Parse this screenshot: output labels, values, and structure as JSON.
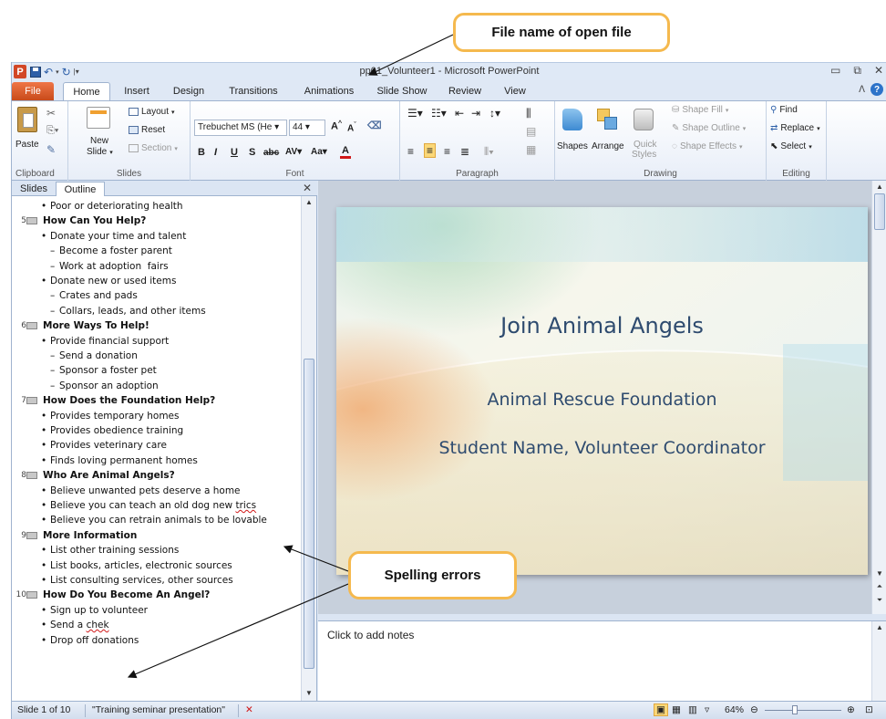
{
  "callouts": {
    "file_name": "File name of open file",
    "spelling": "Spelling errors"
  },
  "window": {
    "title": "pp01_Volunteer1 - Microsoft PowerPoint"
  },
  "tabs": [
    "File",
    "Home",
    "Insert",
    "Design",
    "Transitions",
    "Animations",
    "Slide Show",
    "Review",
    "View"
  ],
  "active_tab": "Home",
  "ribbon": {
    "clipboard": {
      "label": "Clipboard",
      "paste": "Paste"
    },
    "slides": {
      "label": "Slides",
      "new_slide": "New",
      "new_slide2": "Slide",
      "layout": "Layout",
      "reset": "Reset",
      "section": "Section"
    },
    "font": {
      "label": "Font",
      "font_name": "Trebuchet MS (He",
      "font_size": "44"
    },
    "paragraph": {
      "label": "Paragraph"
    },
    "drawing": {
      "label": "Drawing",
      "shapes": "Shapes",
      "arrange": "Arrange",
      "quick": "Quick",
      "styles": "Styles",
      "fill": "Shape Fill",
      "outline": "Shape Outline",
      "effects": "Shape Effects"
    },
    "editing": {
      "label": "Editing",
      "find": "Find",
      "replace": "Replace",
      "select": "Select"
    }
  },
  "pane": {
    "tabs": [
      "Slides",
      "Outline"
    ],
    "active": "Outline"
  },
  "outline": [
    {
      "kind": "bullet",
      "level": 1,
      "text": "Poor or deteriorating health"
    },
    {
      "kind": "title",
      "num": "5",
      "text": "How Can You Help?"
    },
    {
      "kind": "bullet",
      "level": 1,
      "text": "Donate your time and talent"
    },
    {
      "kind": "bullet",
      "level": 2,
      "text": "Become a foster parent"
    },
    {
      "kind": "bullet",
      "level": 2,
      "text": "Work at adoption  fairs"
    },
    {
      "kind": "bullet",
      "level": 1,
      "text": "Donate new or used items"
    },
    {
      "kind": "bullet",
      "level": 2,
      "text": "Crates and pads"
    },
    {
      "kind": "bullet",
      "level": 2,
      "text": "Collars, leads, and other items"
    },
    {
      "kind": "title",
      "num": "6",
      "text": "More Ways To Help!"
    },
    {
      "kind": "bullet",
      "level": 1,
      "text": "Provide financial support"
    },
    {
      "kind": "bullet",
      "level": 2,
      "text": "Send a donation"
    },
    {
      "kind": "bullet",
      "level": 2,
      "text": "Sponsor a foster pet"
    },
    {
      "kind": "bullet",
      "level": 2,
      "text": "Sponsor an adoption"
    },
    {
      "kind": "title",
      "num": "7",
      "text": "How Does the Foundation  Help?"
    },
    {
      "kind": "bullet",
      "level": 1,
      "text": "Provides temporary homes"
    },
    {
      "kind": "bullet",
      "level": 1,
      "text": "Provides obedience training"
    },
    {
      "kind": "bullet",
      "level": 1,
      "text": "Provides veterinary care"
    },
    {
      "kind": "bullet",
      "level": 1,
      "text": "Finds loving permanent homes"
    },
    {
      "kind": "title",
      "num": "8",
      "text": "Who Are Animal Angels?"
    },
    {
      "kind": "bullet",
      "level": 1,
      "text": "Believe unwanted pets deserve a home"
    },
    {
      "kind": "bullet",
      "level": 1,
      "text": "Believe you can teach an old dog new ",
      "misspelled": "trics"
    },
    {
      "kind": "bullet",
      "level": 1,
      "text": "Believe you can retrain animals to be lovable"
    },
    {
      "kind": "title",
      "num": "9",
      "text": "More Information"
    },
    {
      "kind": "bullet",
      "level": 1,
      "text": "List other training sessions"
    },
    {
      "kind": "bullet",
      "level": 1,
      "text": "List books, articles, electronic sources"
    },
    {
      "kind": "bullet",
      "level": 1,
      "text": "List consulting services, other sources"
    },
    {
      "kind": "title",
      "num": "10",
      "text": "How Do You Become  An Angel?"
    },
    {
      "kind": "bullet",
      "level": 1,
      "text": "Sign up to volunteer"
    },
    {
      "kind": "bullet",
      "level": 1,
      "text": "Send a ",
      "misspelled": "chek"
    },
    {
      "kind": "bullet",
      "level": 1,
      "text": "Drop off donations"
    }
  ],
  "slide": {
    "title": "Join Animal Angels",
    "subtitle1": "Animal Rescue Foundation",
    "subtitle2": "Student Name, Volunteer Coordinator"
  },
  "notes": {
    "placeholder": "Click to add notes"
  },
  "status": {
    "slide": "Slide 1 of 10",
    "theme": "\"Training seminar presentation\"",
    "zoom": "64%"
  },
  "colors": {
    "callout_border": "#f5b94e",
    "file_tab": "#d24726",
    "slide_text": "#2e4b6f",
    "spell_underline": "#d01818"
  }
}
